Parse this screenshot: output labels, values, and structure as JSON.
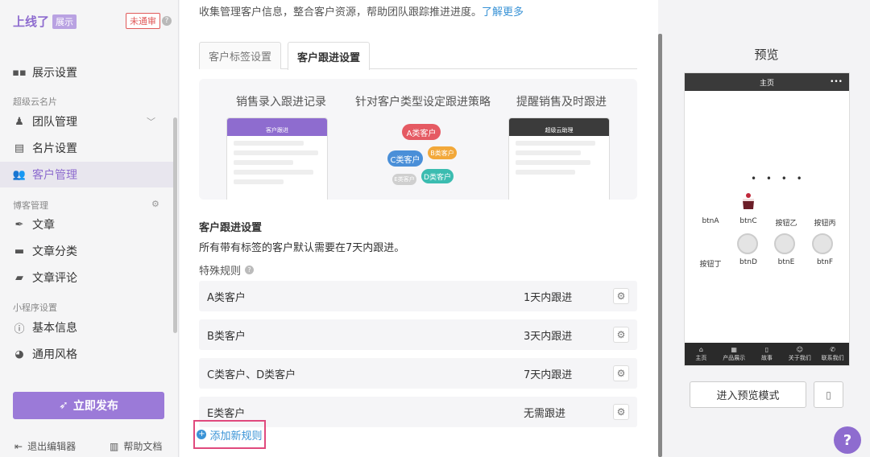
{
  "brand": {
    "name": "上线了",
    "tag": "展示",
    "status": "未通审",
    "help": "?"
  },
  "sidebar": {
    "items": [
      {
        "label": "展示设置",
        "icon": "grid-icon"
      },
      {
        "label": "团队管理",
        "icon": "team-icon"
      },
      {
        "label": "名片设置",
        "icon": "card-icon"
      },
      {
        "label": "客户管理",
        "icon": "users-icon"
      },
      {
        "label": "文章",
        "icon": "quill-icon"
      },
      {
        "label": "文章分类",
        "icon": "folder-icon"
      },
      {
        "label": "文章评论",
        "icon": "comments-icon"
      },
      {
        "label": "基本信息",
        "icon": "info-icon"
      },
      {
        "label": "通用风格",
        "icon": "palette-icon"
      }
    ],
    "sections": {
      "card": "超级云名片",
      "blog": "博客管理",
      "miniapp": "小程序设置"
    },
    "publish": "立即发布",
    "exit": "退出编辑器",
    "help_docs": "帮助文档"
  },
  "main": {
    "intro": "收集管理客户信息，整合客户资源，帮助团队跟踪推进进度。",
    "learn_more": "了解更多",
    "tabs": [
      "客户标签设置",
      "客户跟进设置"
    ],
    "features": [
      "销售录入跟进记录",
      "针对客户类型设定跟进策略",
      "提醒销售及时跟进"
    ],
    "mini_phone_titles": [
      "客户跟进",
      "超级云助理"
    ],
    "pills": [
      "A类客户",
      "C类客户",
      "B类客户",
      "D类客户",
      "E类客户"
    ],
    "follow_title": "客户跟进设置",
    "follow_desc": "所有带有标签的客户默认需要在7天内跟进。",
    "special_rules": "特殊规则",
    "rules": [
      {
        "name": "A类客户",
        "days": "1天内跟进"
      },
      {
        "name": "B类客户",
        "days": "3天内跟进"
      },
      {
        "name": "C类客户、D类客户",
        "days": "7天内跟进"
      },
      {
        "name": "E类客户",
        "days": "无需跟进"
      }
    ],
    "add_rule": "添加新规则"
  },
  "preview": {
    "title": "预览",
    "phone_title": "主页",
    "loading": "• • • •",
    "cells": [
      "btnA",
      "btnC",
      "按钮乙",
      "按钮丙",
      "按钮丁",
      "btnD",
      "btnE",
      "btnF"
    ],
    "nav": [
      "主页",
      "产品展示",
      "故事",
      "关于我们",
      "联系我们"
    ],
    "enter_preview": "进入预览模式"
  },
  "colors": {
    "accent": "#8e6ccf",
    "link": "#3a93d6",
    "highlight": "#e04a7d"
  }
}
